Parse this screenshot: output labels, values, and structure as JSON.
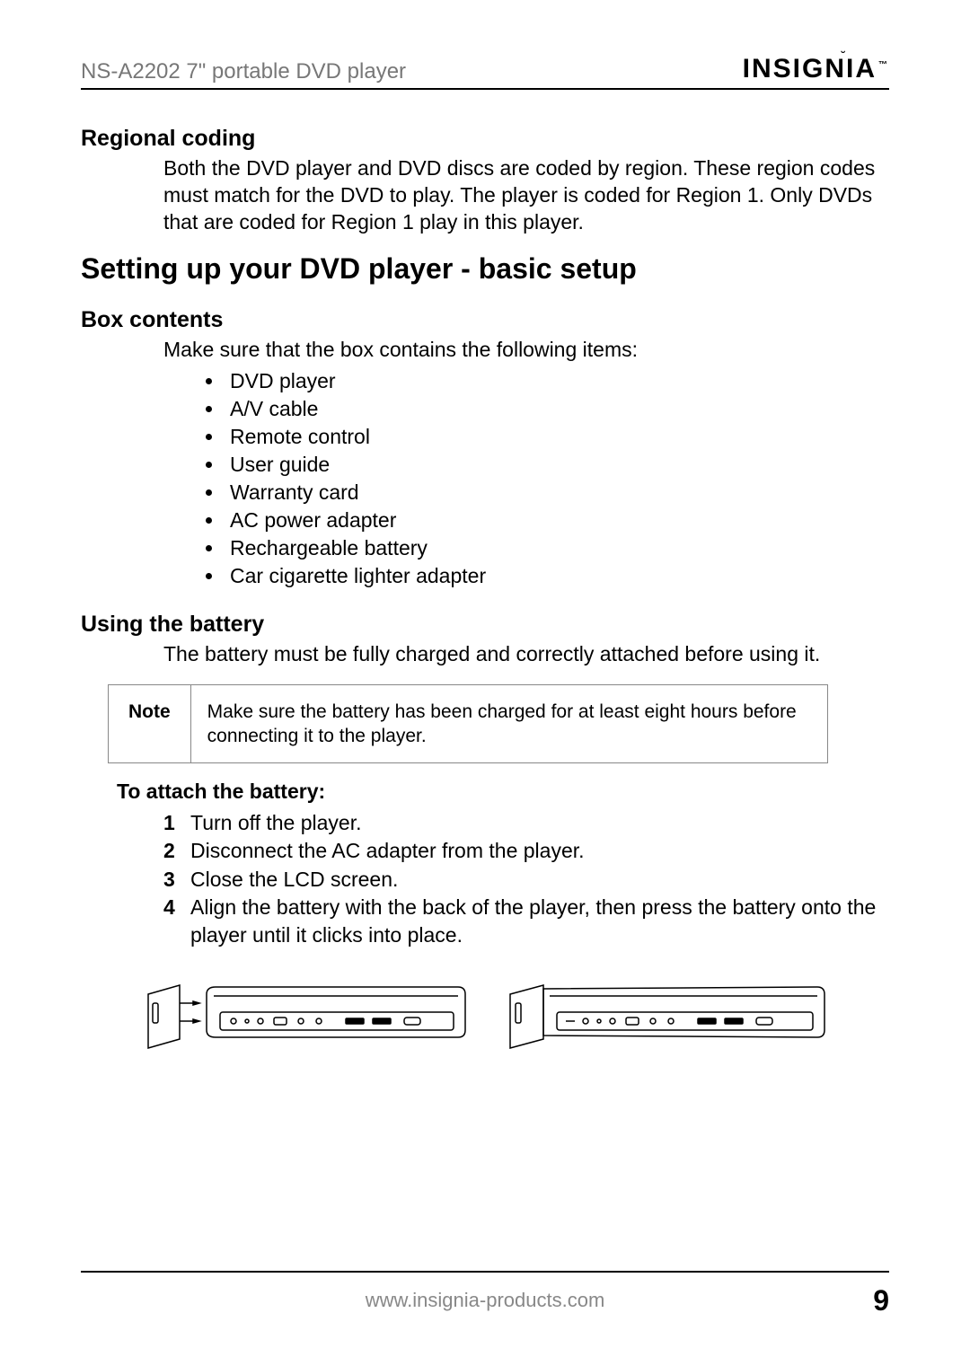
{
  "header": {
    "product": "NS-A2202 7\" portable DVD player",
    "brand": "INSIGNIA",
    "brand_tm": "™"
  },
  "section1": {
    "title": "Regional coding",
    "body": "Both the DVD player and DVD discs are coded by region. These region codes must match for the DVD to play. The player is coded for Region 1. Only DVDs that are coded for Region 1 play in this player."
  },
  "main_title": "Setting up your DVD player - basic setup",
  "box_contents": {
    "title": "Box contents",
    "intro": "Make sure that the box contains the following items:",
    "items": [
      "DVD player",
      "A/V cable",
      "Remote control",
      "User guide",
      "Warranty card",
      "AC power adapter",
      "Rechargeable battery",
      "Car cigarette lighter adapter"
    ]
  },
  "battery": {
    "title": "Using the battery",
    "intro": "The battery must be fully charged and correctly attached before using it.",
    "note_label": "Note",
    "note_text": "Make sure the battery has been charged for at least eight hours before connecting it to the player.",
    "attach_title": "To attach the battery:",
    "steps": [
      "Turn off the player.",
      "Disconnect the AC adapter from the player.",
      "Close the LCD screen.",
      "Align the battery with the back of the player, then press the battery onto the player until it clicks into place."
    ]
  },
  "footer": {
    "url": "www.insignia-products.com",
    "page": "9"
  }
}
